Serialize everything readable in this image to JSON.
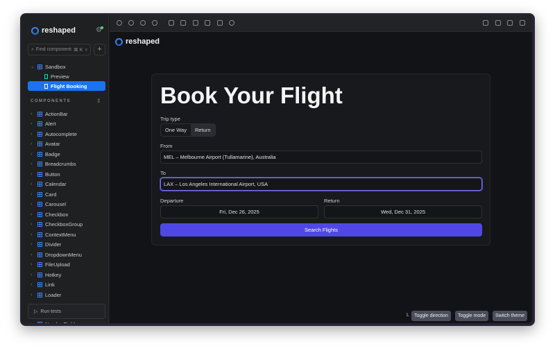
{
  "sidebar": {
    "brand": "reshaped",
    "search_placeholder": "Find components",
    "shortcut": "⌘ K",
    "sandbox": "Sandbox",
    "stories": [
      "Preview",
      "Flight Booking"
    ],
    "section": "COMPONENTS",
    "components": [
      "ActionBar",
      "Alert",
      "Autocomplete",
      "Avatar",
      "Badge",
      "Breadcrumbs",
      "Button",
      "Calendar",
      "Card",
      "Carousel",
      "Checkbox",
      "CheckboxGroup",
      "ContextMenu",
      "Divider",
      "DropdownMenu",
      "FileUpload",
      "Hotkey",
      "Link",
      "Loader",
      "NumberField"
    ],
    "run_tests": "Run tests"
  },
  "preview": {
    "brand": "reshaped",
    "title": "Book Your Flight",
    "trip_type_label": "Trip type",
    "trip_options": [
      "One Way",
      "Return"
    ],
    "from_label": "From",
    "from_value": "MEL – Melbourne Airport (Tullamarine), Australia",
    "to_label": "To",
    "to_value": "LAX – Los Angeles International Airport, USA",
    "departure_label": "Departure",
    "departure_value": "Fri, Dec 26, 2025",
    "return_label": "Return",
    "return_value": "Wed, Dec 31, 2025",
    "submit": "Search Flights"
  },
  "footer": {
    "hotkey": "L",
    "buttons": [
      "Toggle direction",
      "Toggle mode",
      "Switch theme"
    ]
  }
}
